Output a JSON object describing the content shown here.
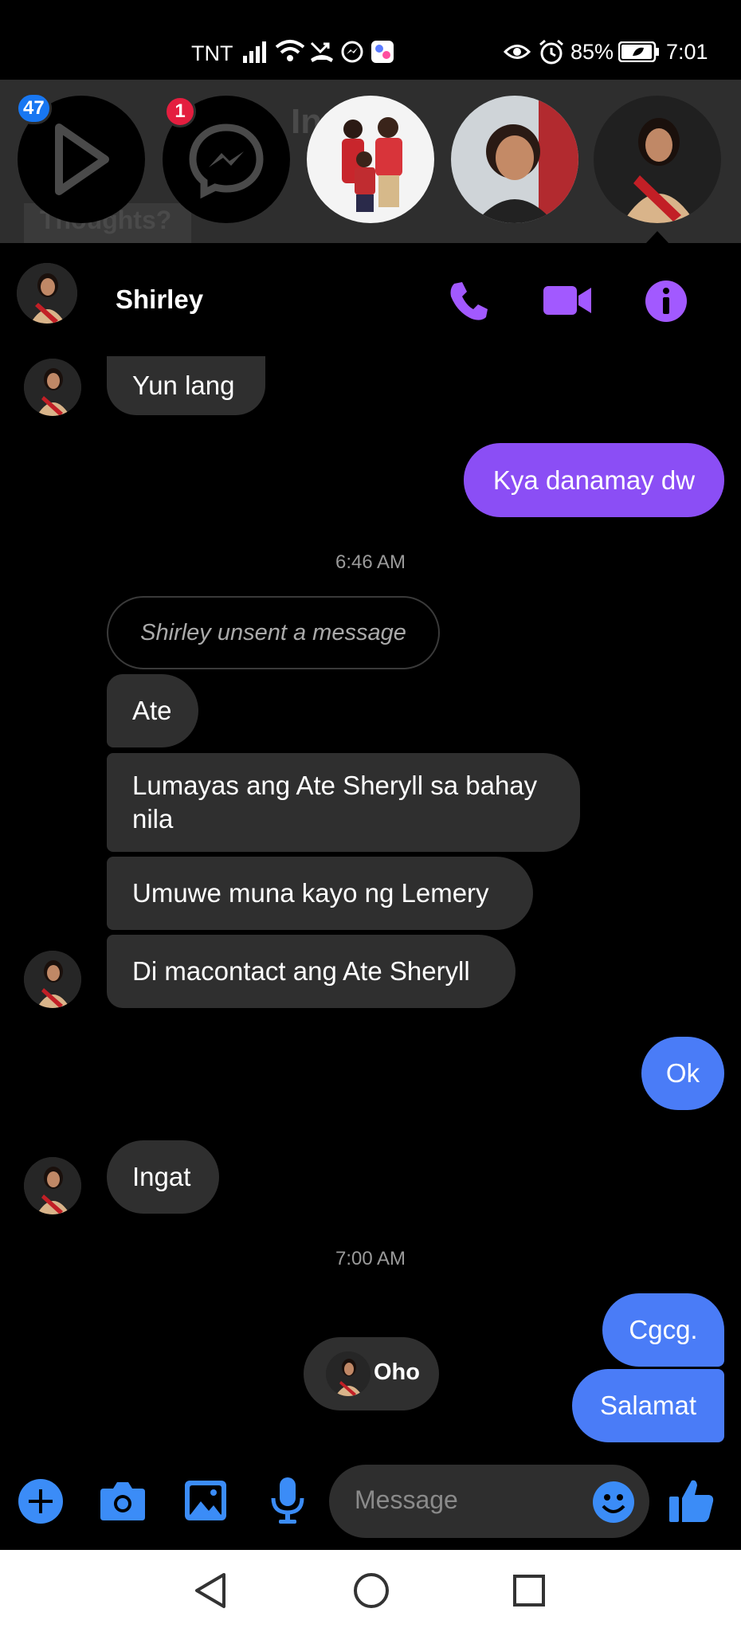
{
  "status_bar": {
    "carrier": "TNT",
    "battery": "85%",
    "time": "7:01"
  },
  "chat_heads": {
    "background_title": "In",
    "background_prompt": "Thoughts?",
    "items": [
      {
        "badge": "47",
        "badge_color": "#1877f2"
      },
      {
        "badge": "1",
        "badge_color": "#e41e3f"
      }
    ]
  },
  "header": {
    "contact_name": "Shirley"
  },
  "messages": [
    {
      "text": "Yun lang"
    },
    {
      "text": "Kya danamay dw"
    },
    {
      "timestamp": "6:46 AM"
    },
    {
      "text": "Shirley unsent a message"
    },
    {
      "text": "Ate"
    },
    {
      "line1": "Lumayas ang Ate Sheryll sa bahay",
      "line2": "nila"
    },
    {
      "text": "Umuwe muna kayo ng Lemery"
    },
    {
      "text": "Di macontact ang Ate Sheryll"
    },
    {
      "text": "Ok"
    },
    {
      "text": "Ingat"
    },
    {
      "timestamp": "7:00 AM"
    },
    {
      "text": "Cgcg."
    },
    {
      "text": "Oho"
    },
    {
      "text": "Salamat"
    }
  ],
  "composer": {
    "placeholder": "Message"
  },
  "colors": {
    "accent_purple": "#8b4ef5",
    "accent_blue": "#4a7cf7",
    "incoming_bubble": "#2f2f2f",
    "icon_blue": "#3b8cf7",
    "header_icon_purple": "#a259ff"
  }
}
